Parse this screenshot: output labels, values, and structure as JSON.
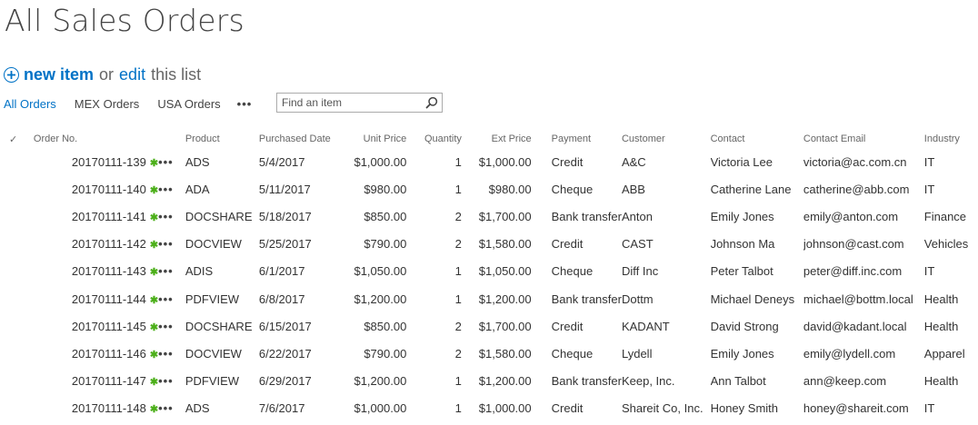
{
  "page": {
    "title": "All Sales Orders"
  },
  "actions": {
    "new_item": "new item",
    "or": "or",
    "edit": "edit",
    "this_list": "this list"
  },
  "views": [
    {
      "label": "All Orders",
      "active": true
    },
    {
      "label": "MEX Orders",
      "active": false
    },
    {
      "label": "USA Orders",
      "active": false
    }
  ],
  "views_more": "•••",
  "search": {
    "placeholder": "Find an item",
    "value": ""
  },
  "colors": {
    "accent": "#0072c6",
    "new_marker": "#4caf1a"
  },
  "columns": {
    "check": "✓",
    "order_no": "Order No.",
    "product": "Product",
    "purchased_date": "Purchased Date",
    "unit_price": "Unit Price",
    "quantity": "Quantity",
    "ext_price": "Ext Price",
    "payment": "Payment",
    "customer": "Customer",
    "contact": "Contact",
    "contact_email": "Contact Email",
    "industry": "Industry"
  },
  "row_menu": "•••",
  "new_marker": "✱",
  "rows": [
    {
      "order_no": "20170111-139",
      "product": "ADS",
      "date": "5/4/2017",
      "unit_price": "$1,000.00",
      "quantity": "1",
      "ext_price": "$1,000.00",
      "payment": "Credit",
      "customer": "A&C",
      "contact": "Victoria Lee",
      "email": "victoria@ac.com.cn",
      "industry": "IT"
    },
    {
      "order_no": "20170111-140",
      "product": "ADA",
      "date": "5/11/2017",
      "unit_price": "$980.00",
      "quantity": "1",
      "ext_price": "$980.00",
      "payment": "Cheque",
      "customer": "ABB",
      "contact": "Catherine Lane",
      "email": "catherine@abb.com",
      "industry": "IT"
    },
    {
      "order_no": "20170111-141",
      "product": "DOCSHARE",
      "date": "5/18/2017",
      "unit_price": "$850.00",
      "quantity": "2",
      "ext_price": "$1,700.00",
      "payment": "Bank transfer",
      "customer": "Anton",
      "contact": "Emily Jones",
      "email": "emily@anton.com",
      "industry": "Finance"
    },
    {
      "order_no": "20170111-142",
      "product": "DOCVIEW",
      "date": "5/25/2017",
      "unit_price": "$790.00",
      "quantity": "2",
      "ext_price": "$1,580.00",
      "payment": "Credit",
      "customer": "CAST",
      "contact": "Johnson Ma",
      "email": "johnson@cast.com",
      "industry": "Vehicles"
    },
    {
      "order_no": "20170111-143",
      "product": "ADIS",
      "date": "6/1/2017",
      "unit_price": "$1,050.00",
      "quantity": "1",
      "ext_price": "$1,050.00",
      "payment": "Cheque",
      "customer": "Diff Inc",
      "contact": "Peter Talbot",
      "email": "peter@diff.inc.com",
      "industry": "IT"
    },
    {
      "order_no": "20170111-144",
      "product": "PDFVIEW",
      "date": "6/8/2017",
      "unit_price": "$1,200.00",
      "quantity": "1",
      "ext_price": "$1,200.00",
      "payment": "Bank transfer",
      "customer": "Dottm",
      "contact": "Michael Deneys",
      "email": "michael@bottm.local",
      "industry": "Health"
    },
    {
      "order_no": "20170111-145",
      "product": "DOCSHARE",
      "date": "6/15/2017",
      "unit_price": "$850.00",
      "quantity": "2",
      "ext_price": "$1,700.00",
      "payment": "Credit",
      "customer": "KADANT",
      "contact": "David Strong",
      "email": "david@kadant.local",
      "industry": "Health"
    },
    {
      "order_no": "20170111-146",
      "product": "DOCVIEW",
      "date": "6/22/2017",
      "unit_price": "$790.00",
      "quantity": "2",
      "ext_price": "$1,580.00",
      "payment": "Cheque",
      "customer": "Lydell",
      "contact": "Emily Jones",
      "email": "emily@lydell.com",
      "industry": "Apparel"
    },
    {
      "order_no": "20170111-147",
      "product": "PDFVIEW",
      "date": "6/29/2017",
      "unit_price": "$1,200.00",
      "quantity": "1",
      "ext_price": "$1,200.00",
      "payment": "Bank transfer",
      "customer": "Keep, Inc.",
      "contact": "Ann Talbot",
      "email": "ann@keep.com",
      "industry": "Health"
    },
    {
      "order_no": "20170111-148",
      "product": "ADS",
      "date": "7/6/2017",
      "unit_price": "$1,000.00",
      "quantity": "1",
      "ext_price": "$1,000.00",
      "payment": "Credit",
      "customer": "Shareit Co, Inc.",
      "contact": "Honey Smith",
      "email": "honey@shareit.com",
      "industry": "IT"
    }
  ]
}
